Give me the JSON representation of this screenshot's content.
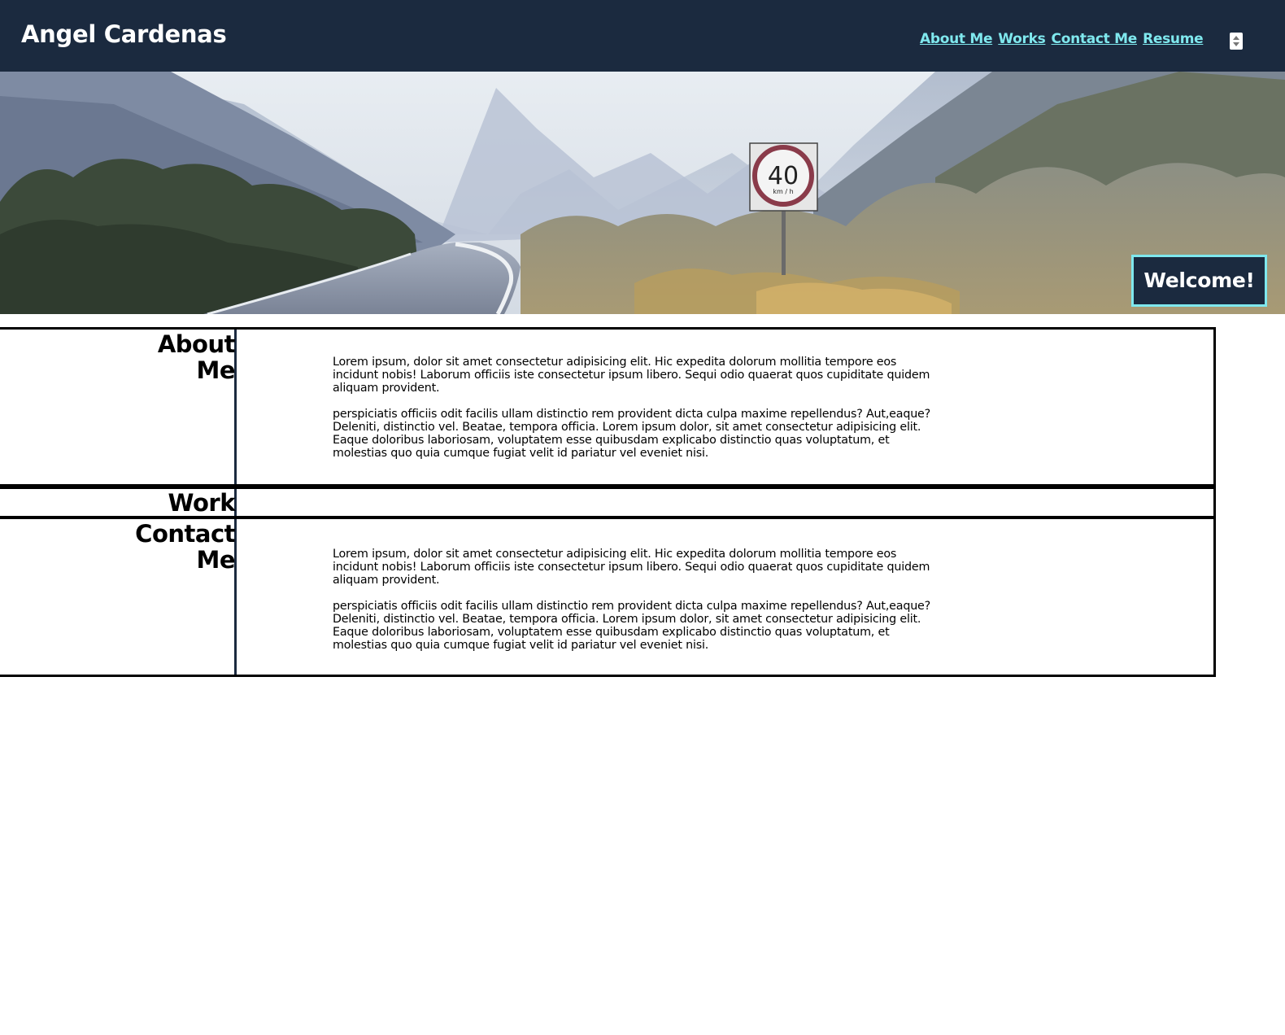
{
  "header": {
    "title": "Angel Cardenas",
    "nav": [
      {
        "label": "About Me"
      },
      {
        "label": "Works"
      },
      {
        "label": "Contact Me"
      },
      {
        "label": "Resume"
      }
    ]
  },
  "hero": {
    "sign_text": "40",
    "sign_unit": "km / h",
    "welcome": "Welcome!"
  },
  "sections": {
    "about": {
      "title_line1": "About",
      "title_line2": "Me",
      "paragraph1": "Lorem ipsum, dolor sit amet consectetur adipisicing elit. Hic expedita dolorum mollitia tempore eos incidunt nobis! Laborum officiis iste consectetur ipsum libero. Sequi odio quaerat quos cupiditate quidem aliquam provident.",
      "paragraph2": "perspiciatis officiis odit facilis ullam distinctio rem provident dicta culpa maxime repellendus? Aut,eaque? Deleniti, distinctio vel. Beatae, tempora officia. Lorem ipsum dolor, sit amet consectetur adipisicing elit. Eaque doloribus laboriosam, voluptatem esse quibusdam explicabo distinctio quas voluptatum, et molestias quo quia cumque fugiat velit id pariatur vel eveniet nisi."
    },
    "work": {
      "title": "Work"
    },
    "contact": {
      "title_line1": "Contact",
      "title_line2": "Me",
      "paragraph1": "Lorem ipsum, dolor sit amet consectetur adipisicing elit. Hic expedita dolorum mollitia tempore eos incidunt nobis! Laborum officiis iste consectetur ipsum libero. Sequi odio quaerat quos cupiditate quidem aliquam provident.",
      "paragraph2": "perspiciatis officiis odit facilis ullam distinctio rem provident dicta culpa maxime repellendus? Aut,eaque? Deleniti, distinctio vel. Beatae, tempora officia. Lorem ipsum dolor, sit amet consectetur adipisicing elit. Eaque doloribus laboriosam, voluptatem esse quibusdam explicabo distinctio quas voluptatum, et molestias quo quia cumque fugiat velit id pariatur vel eveniet nisi."
    }
  },
  "colors": {
    "header_bg": "#1b2a3f",
    "accent": "#7fe8ee",
    "text": "#000000"
  }
}
